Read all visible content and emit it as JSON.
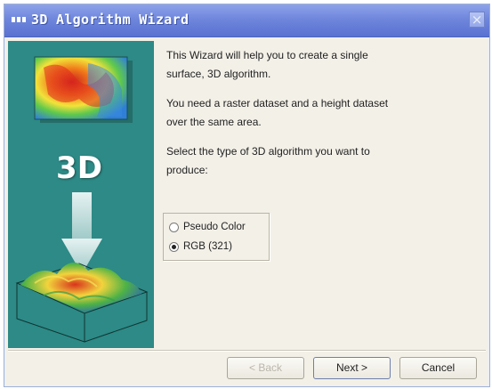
{
  "window": {
    "title": "3D Algorithm Wizard",
    "close_glyph": "×"
  },
  "side_panel": {
    "label": "3D",
    "background": "#2d8a86"
  },
  "content": {
    "intro": "This Wizard will help you to create a single surface, 3D algorithm.",
    "requirement": "You need a raster dataset and a height dataset over the same area.",
    "prompt": "Select the type of 3D algorithm you want to produce:"
  },
  "options": [
    {
      "label": "Pseudo Color",
      "checked": false
    },
    {
      "label": "RGB (321)",
      "checked": true
    }
  ],
  "buttons": {
    "back": "< Back",
    "next": "Next >",
    "cancel": "Cancel"
  },
  "colors": {
    "titlebar": "#6f86dc",
    "dialog_bg": "#f3f0e8"
  }
}
